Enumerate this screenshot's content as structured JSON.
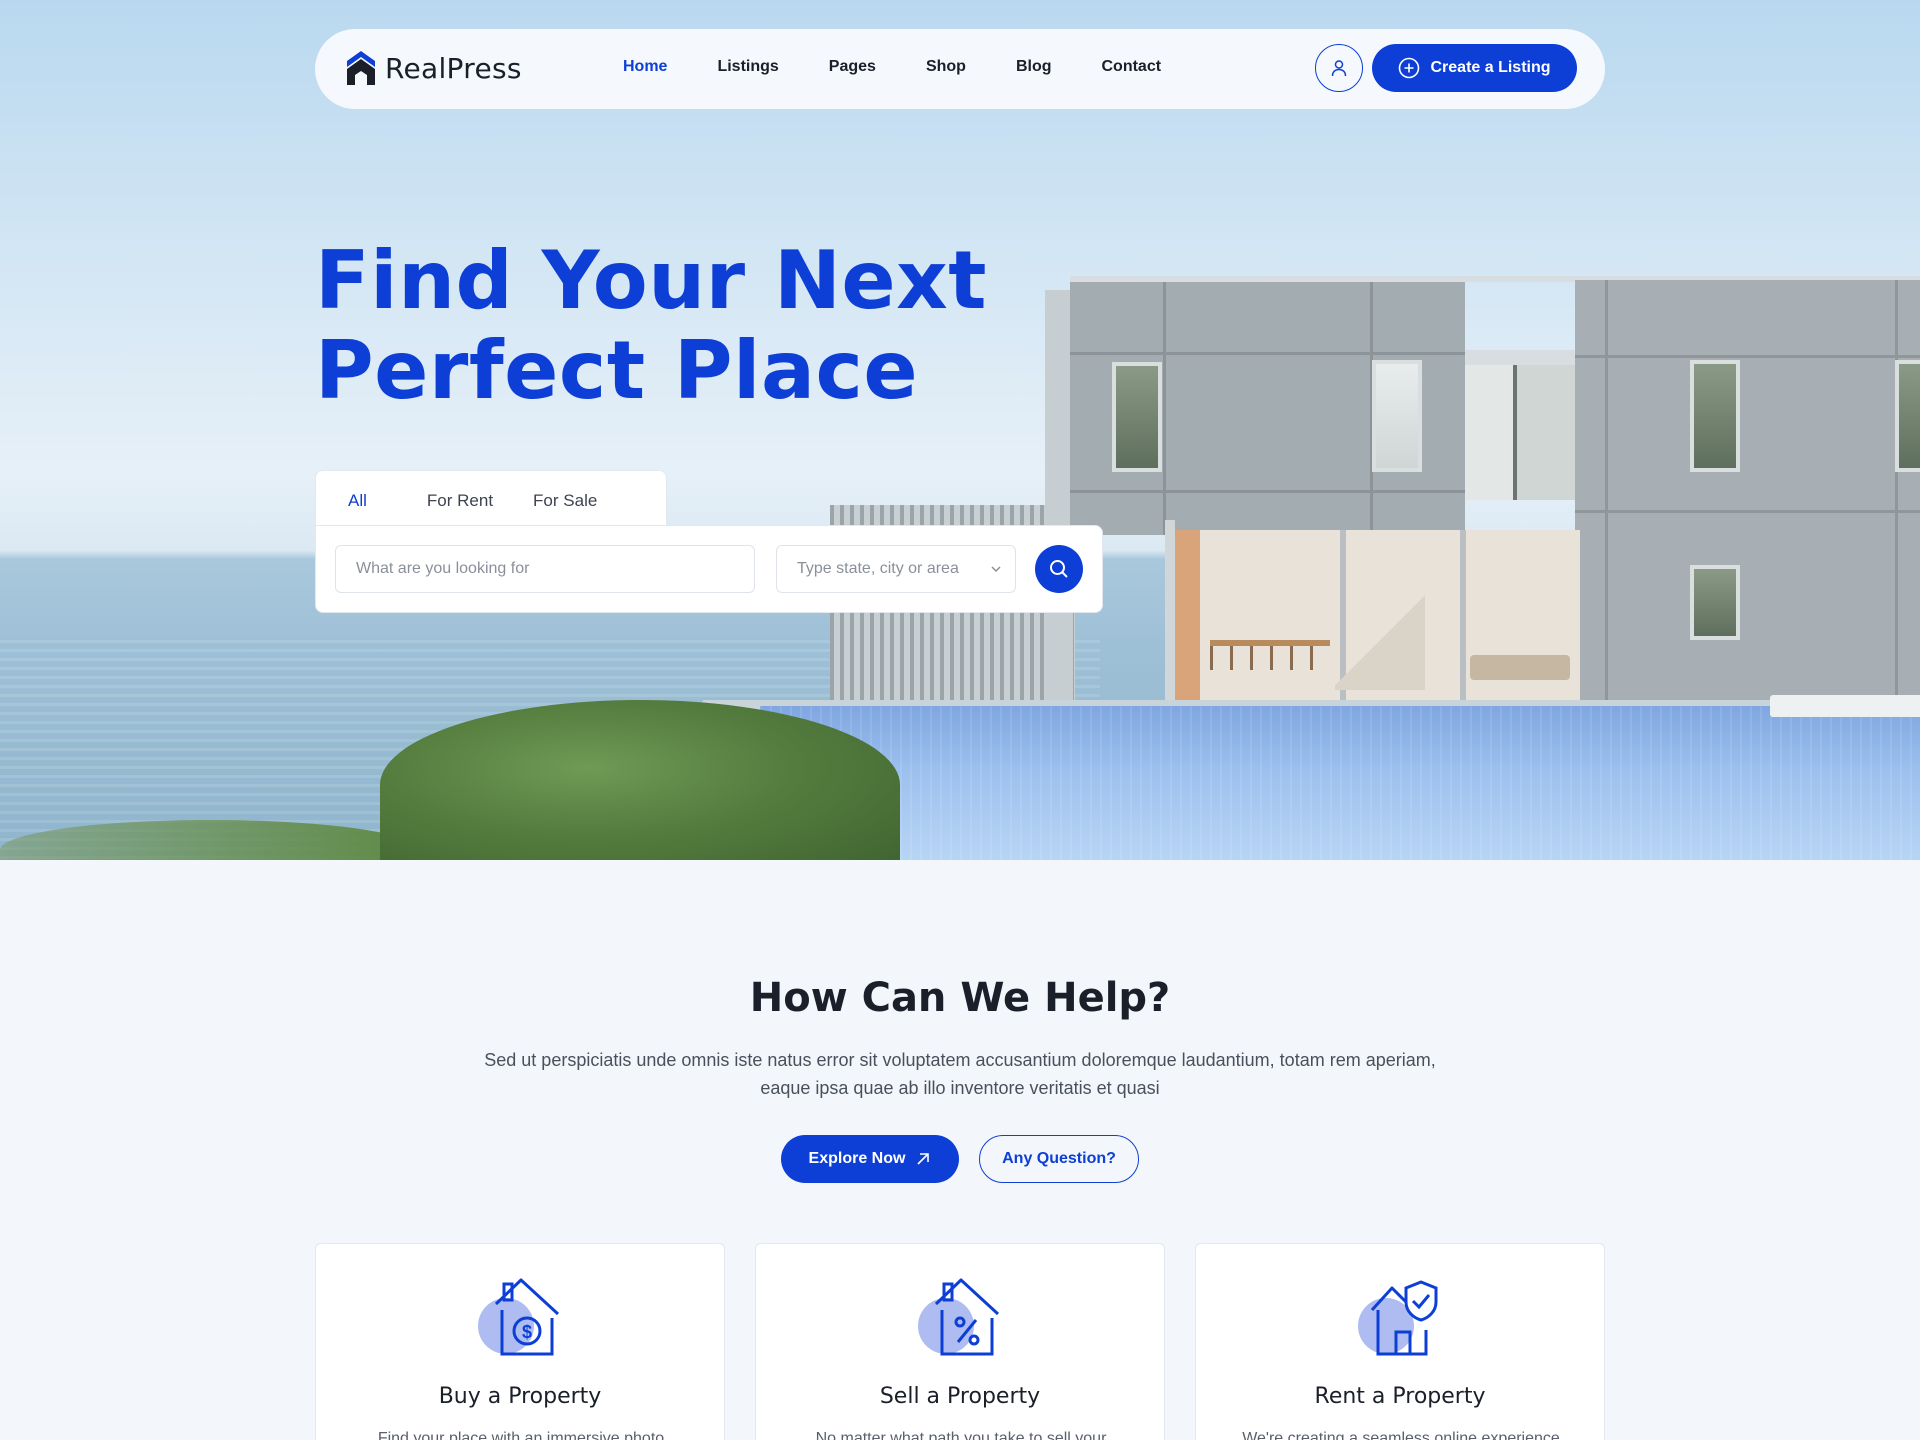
{
  "brand": {
    "name": "RealPress",
    "accent": "#0d3fd6"
  },
  "nav": {
    "links": [
      "Home",
      "Listings",
      "Pages",
      "Shop",
      "Blog",
      "Contact"
    ],
    "active": "Home",
    "cta_label": "Create a Listing"
  },
  "hero": {
    "headline_line1": "Find Your Next",
    "headline_line2": "Perfect Place"
  },
  "search": {
    "tabs": [
      "All",
      "For Rent",
      "For Sale"
    ],
    "active_tab": "All",
    "what_placeholder": "What are you looking for",
    "where_placeholder": "Type state, city or area"
  },
  "help": {
    "title": "How Can We Help?",
    "description_line1": "Sed ut perspiciatis unde omnis iste natus error sit voluptatem accusantium doloremque laudantium, totam rem aperiam,",
    "description_line2": "eaque ipsa quae ab illo inventore veritatis et quasi",
    "explore_label": "Explore Now",
    "question_label": "Any Question?"
  },
  "cards": [
    {
      "title": "Buy a Property",
      "text": "Find your place with an immersive photo",
      "icon": "house-dollar-icon"
    },
    {
      "title": "Sell a Property",
      "text": "No matter what path you take to sell your",
      "icon": "house-percent-icon"
    },
    {
      "title": "Rent a Property",
      "text": "We're creating a seamless online experience",
      "icon": "house-shield-icon"
    }
  ]
}
